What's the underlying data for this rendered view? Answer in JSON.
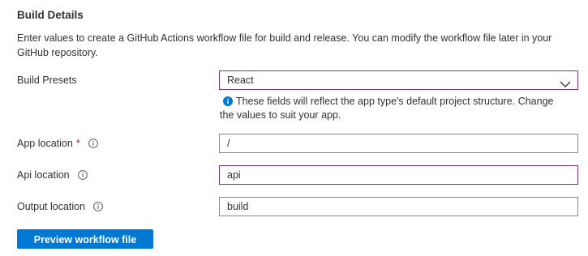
{
  "section": {
    "title": "Build Details",
    "description": "Enter values to create a GitHub Actions workflow file for build and release. You can modify the workflow file later in your GitHub repository."
  },
  "build_presets": {
    "label": "Build Presets",
    "selected": "React",
    "hint": "These fields will reflect the app type's default project structure. Change the values to suit your app."
  },
  "app_location": {
    "label": "App location",
    "required_marker": "*",
    "value": "/"
  },
  "api_location": {
    "label": "Api location",
    "value": "api"
  },
  "output_location": {
    "label": "Output location",
    "value": "build"
  },
  "actions": {
    "preview_label": "Preview workflow file"
  },
  "colors": {
    "primary_button": "#0078d4",
    "focus_border": "#8a2d8c",
    "required": "#a4262c",
    "info_hint_icon": "#0078d4"
  },
  "icons": {
    "field_info": "info-circle-outline-icon",
    "hint_info": "info-circle-filled-icon",
    "dropdown": "chevron-down-icon"
  }
}
